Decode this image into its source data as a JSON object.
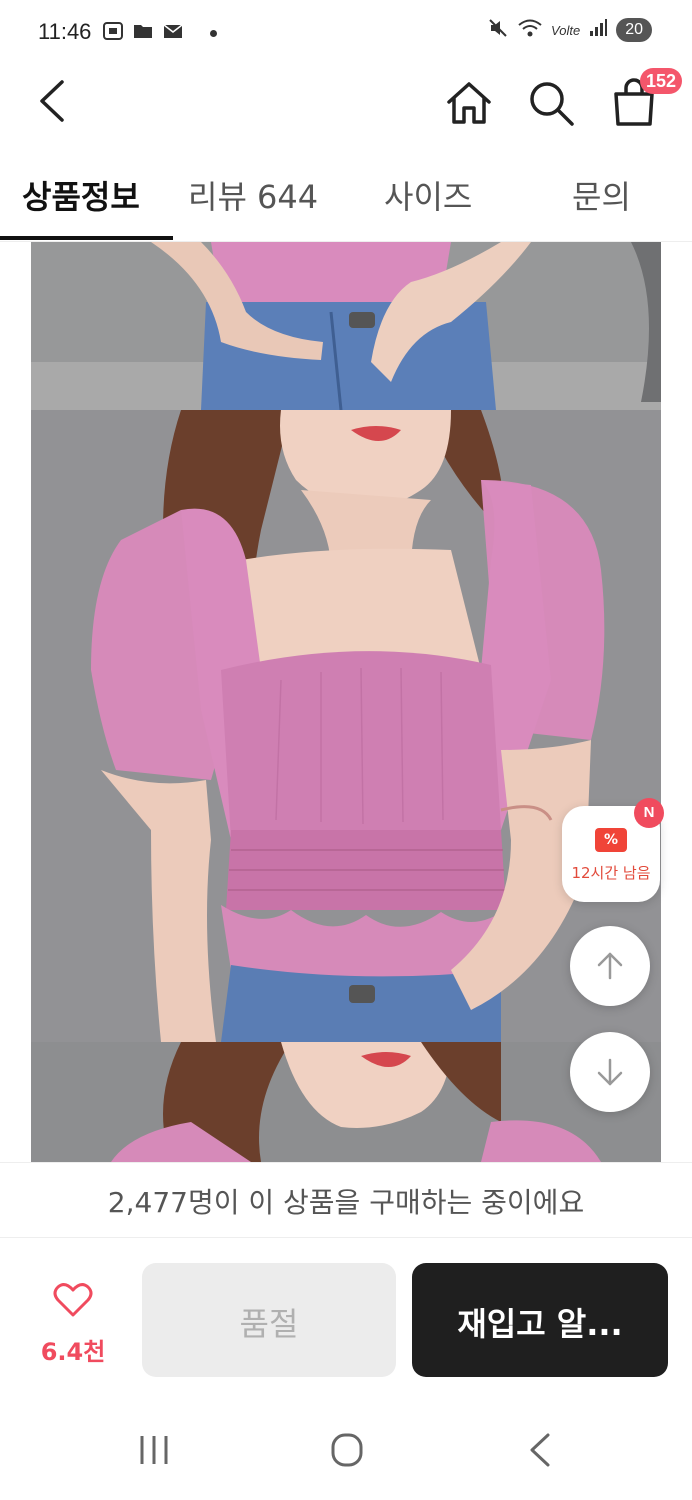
{
  "status_bar": {
    "time": "11:46",
    "battery": "20",
    "network_label": "Volte"
  },
  "header": {
    "cart_count": "152"
  },
  "tabs": [
    {
      "label": "상품정보",
      "active": true
    },
    {
      "label": "리뷰 644",
      "active": false
    },
    {
      "label": "사이즈",
      "active": false
    },
    {
      "label": "문의",
      "active": false
    }
  ],
  "floating": {
    "coupon_icon": "%",
    "coupon_text": "12시간 남음",
    "coupon_badge": "N"
  },
  "purchase_banner": {
    "text": "2,477명이 이 상품을 구매하는 중이에요"
  },
  "bottom_bar": {
    "like_count": "6.4천",
    "soldout_label": "품절",
    "restock_label": "재입고 알..."
  },
  "colors": {
    "accent": "#f04b5e",
    "dark_button": "#1f1f1f",
    "disabled_button": "#ececec",
    "blouse_pink": "#d98bbd"
  }
}
